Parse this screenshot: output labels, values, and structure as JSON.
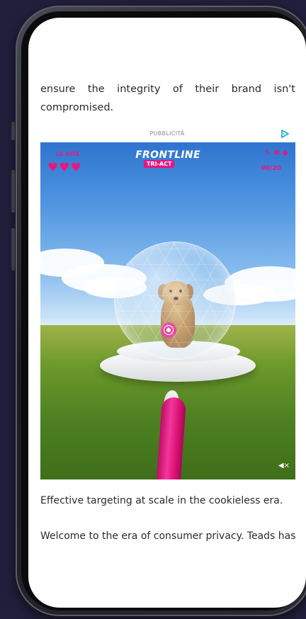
{
  "article": {
    "top_paragraph": "ensure the integrity of their brand isn't compromised.",
    "bottom_paragraph_1": "Effective targeting at scale in the cookieless era.",
    "bottom_paragraph_2": "Welcome to the era of consumer privacy. Teads has"
  },
  "ad": {
    "label": "PUBBLICITÀ",
    "brand": "FRONTLINE",
    "brand_sub": "TRI-ACT",
    "lives_label": "LE VITE",
    "hearts": "♥♥♥",
    "score": "00/20",
    "pest_icons": "✎ ✱ ◆",
    "mute_icon": "◀×",
    "adchoices_icon": "adchoices-icon",
    "accent_color": "#e8177f"
  }
}
